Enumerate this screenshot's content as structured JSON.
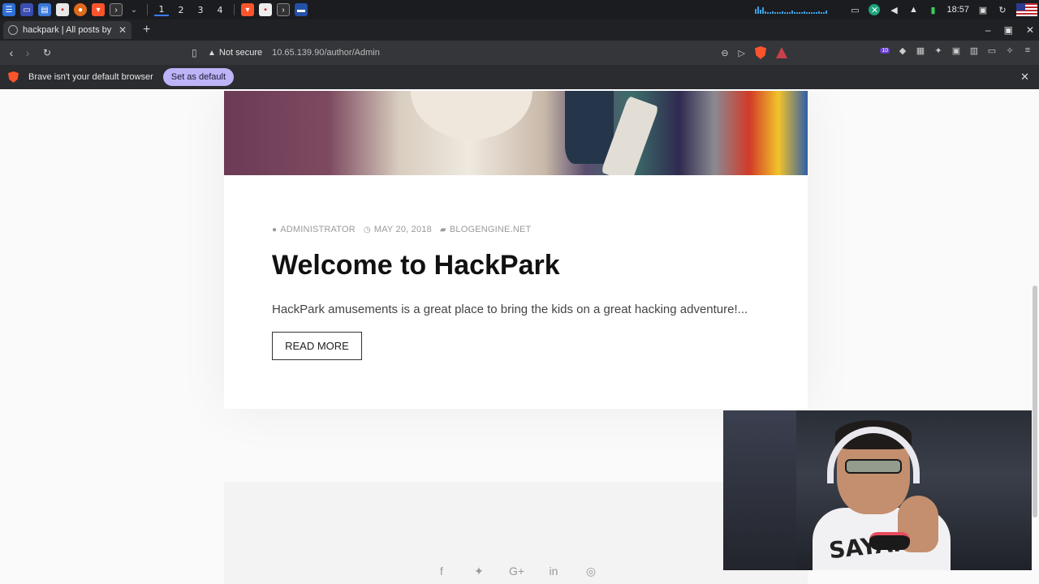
{
  "taskbar": {
    "workspaces": [
      "1",
      "2",
      "3",
      "4"
    ],
    "clock": "18:57"
  },
  "browser": {
    "tab_title": "hackpark | All posts by admin",
    "new_tab": "+",
    "security_label": "Not secure",
    "url": "10.65.139.90/author/Admin",
    "extension_badge": "10"
  },
  "infobar": {
    "message": "Brave isn't your default browser",
    "button_label": "Set as default"
  },
  "post": {
    "author": "ADMINISTRATOR",
    "date": "MAY 20, 2018",
    "category": "BLOGENGINE.NET",
    "title": "Welcome to HackPark",
    "excerpt": "HackPark amusements is a great place to bring the kids on a great hacking adventure!...",
    "read_more": "READ MORE"
  },
  "footer": {
    "social": [
      "facebook-icon",
      "twitter-icon",
      "google-plus-icon",
      "linkedin-icon",
      "instagram-icon"
    ]
  },
  "webcam": {
    "shirt_text": "SAYANA"
  },
  "colors": {
    "brand_brave": "#fb542b",
    "infobar_button": "#bdb3f7",
    "page_bg": "#fafafa"
  }
}
